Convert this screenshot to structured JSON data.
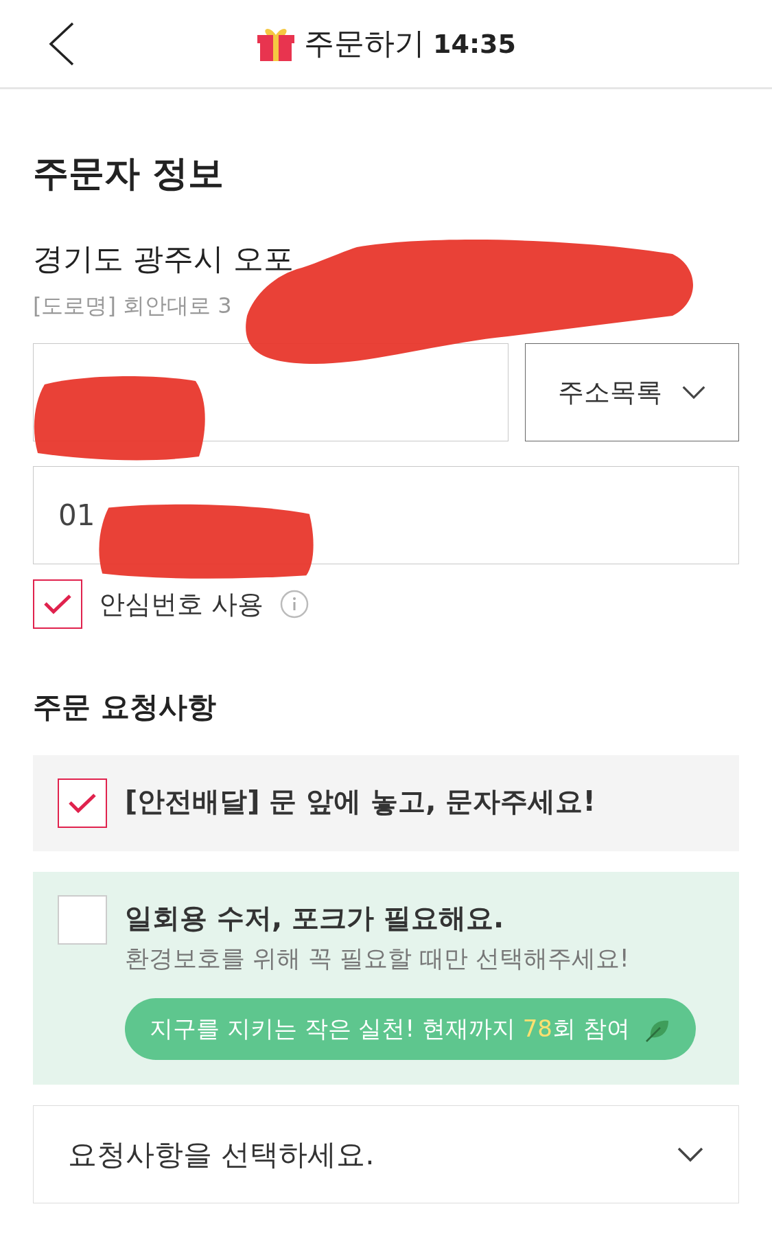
{
  "header": {
    "title": "주문하기",
    "time": "14:35"
  },
  "orderer": {
    "title": "주문자 정보",
    "address_line": "경기도 광주시 오포",
    "road_line": "[도로명] 회안대로 3",
    "address_list_button": "주소목록",
    "phone_value": "01",
    "safe_number": {
      "label": "안심번호 사용",
      "checked": true
    }
  },
  "requests": {
    "title": "주문 요청사항",
    "options": [
      {
        "kind": "plain",
        "label": "[안전배달] 문 앞에 놓고, 문자주세요!",
        "checked": true
      },
      {
        "kind": "eco",
        "label": "일회용 수저, 포크가 필요해요.",
        "note": "환경보호를 위해 꼭 필요할 때만 선택해주세요!",
        "badge_prefix": "지구를 지키는 작은 실천! 현재까지 ",
        "badge_count": "78",
        "badge_suffix": "회 참여",
        "checked": false
      }
    ],
    "select_placeholder": "요청사항을 선택하세요."
  }
}
